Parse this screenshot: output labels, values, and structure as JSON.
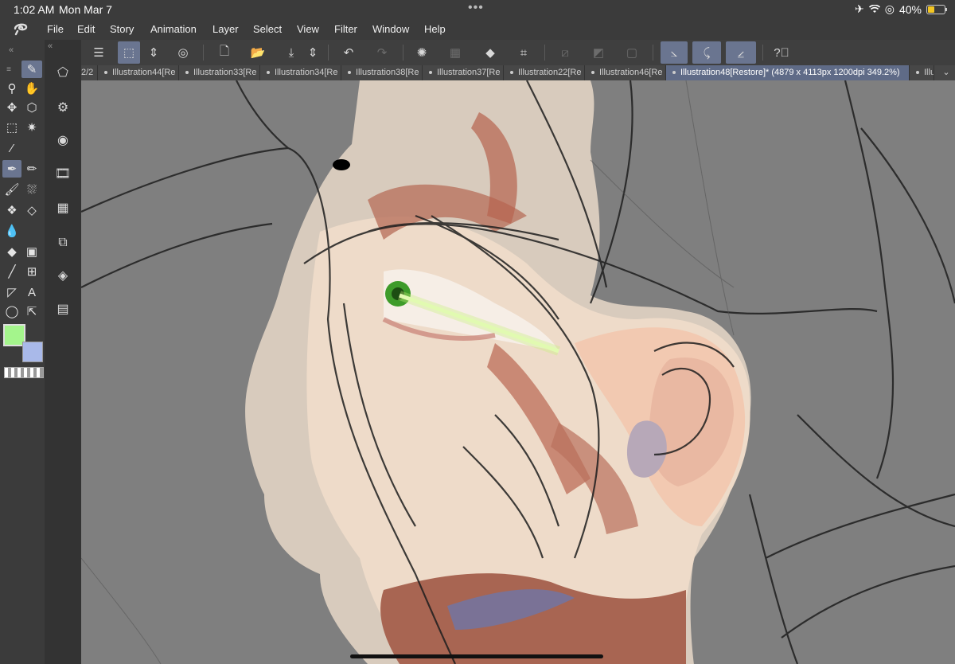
{
  "status": {
    "time": "1:02 AM",
    "date": "Mon Mar 7",
    "battery": "40%",
    "dots": "•••"
  },
  "menu": [
    "File",
    "Edit",
    "Story",
    "Animation",
    "Layer",
    "Select",
    "View",
    "Filter",
    "Window",
    "Help"
  ],
  "tabs": [
    {
      "label": "2/2",
      "active": false
    },
    {
      "label": "Illustration44[Re",
      "active": false
    },
    {
      "label": "Illustration33[Re",
      "active": false
    },
    {
      "label": "Illustration34[Re",
      "active": false
    },
    {
      "label": "Illustration38[Re",
      "active": false
    },
    {
      "label": "Illustration37[Re",
      "active": false
    },
    {
      "label": "Illustration22[Re",
      "active": false
    },
    {
      "label": "Illustration46[Re",
      "active": false
    },
    {
      "label": "Illustration48[Restore]* (4879 x 4113px 1200dpi 349.2%)",
      "active": true
    },
    {
      "label": "Illu",
      "active": false
    }
  ],
  "colors": {
    "main": "#a4f58c",
    "sub": "#a9b9e9",
    "accent": "#6a7590",
    "canvas": "#7f7f7f"
  },
  "icons": {
    "app_logo": "clip-studio-logo-icon",
    "airplane": "airplane-icon",
    "wifi": "wifi-icon",
    "lock": "orientation-lock-icon"
  }
}
